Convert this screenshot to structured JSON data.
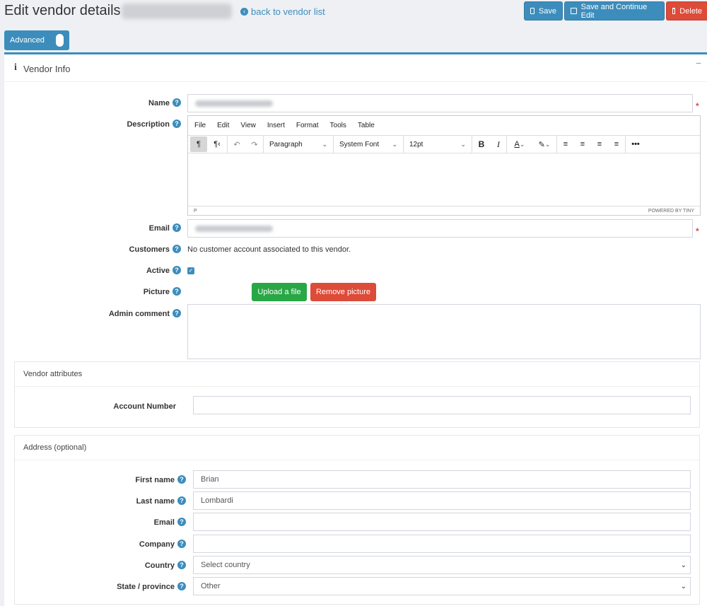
{
  "header": {
    "title": "Edit vendor details",
    "back_link": "back to vendor list",
    "save": "Save",
    "save_continue": "Save and Continue Edit",
    "delete": "Delete"
  },
  "advanced": {
    "label": "Advanced"
  },
  "panel": {
    "title": "Vendor Info",
    "collapse": "−"
  },
  "fields": {
    "name_label": "Name",
    "description_label": "Description",
    "email_label": "Email",
    "customers_label": "Customers",
    "customers_value": "No customer account associated to this vendor.",
    "active_label": "Active",
    "picture_label": "Picture",
    "upload": "Upload a file",
    "remove": "Remove picture",
    "admin_comment_label": "Admin comment"
  },
  "editor": {
    "menus": [
      "File",
      "Edit",
      "View",
      "Insert",
      "Format",
      "Tools",
      "Table"
    ],
    "block_format": "Paragraph",
    "font_family": "System Font",
    "font_size": "12pt",
    "status_path": "P",
    "powered": "POWERED BY TINY"
  },
  "vendor_attributes": {
    "title": "Vendor attributes",
    "account_number_label": "Account Number"
  },
  "address": {
    "title": "Address (optional)",
    "first_name_label": "First name",
    "first_name_value": "Brian",
    "last_name_label": "Last name",
    "last_name_value": "Lombardi",
    "email_label": "Email",
    "company_label": "Company",
    "country_label": "Country",
    "country_value": "Select country",
    "state_label": "State / province",
    "state_value": "Other"
  },
  "colors": {
    "primary": "#3c8dbc",
    "danger": "#dd4b39",
    "success": "#28a745"
  }
}
